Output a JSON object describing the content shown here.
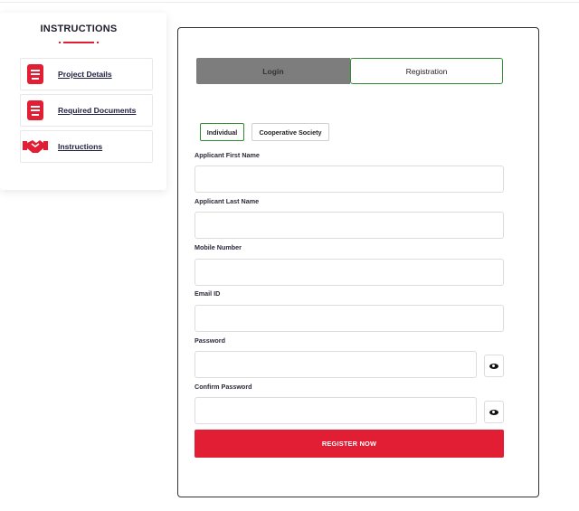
{
  "sidebar": {
    "title": "INSTRUCTIONS",
    "items": [
      {
        "label": "Project Details",
        "icon": "book-icon"
      },
      {
        "label": "Required Documents",
        "icon": "book-icon"
      },
      {
        "label": "Instructions",
        "icon": "handshake-icon"
      }
    ]
  },
  "tabs": {
    "login": "Login",
    "registration": "Registration",
    "active": "Registration"
  },
  "applicant_types": {
    "individual": "Individual",
    "cooperative": "Cooperative Society",
    "selected": "Individual"
  },
  "form": {
    "first_name": {
      "label": "Applicant First Name",
      "value": ""
    },
    "last_name": {
      "label": "Applicant Last Name",
      "value": ""
    },
    "mobile": {
      "label": "Mobile Number",
      "value": ""
    },
    "email": {
      "label": "Email ID",
      "value": ""
    },
    "password": {
      "label": "Password",
      "value": ""
    },
    "confirm_password": {
      "label": "Confirm Password",
      "value": ""
    },
    "submit_label": "REGISTER NOW"
  },
  "colors": {
    "accent_red": "#e21e35",
    "active_green": "#2e8b2e",
    "inactive_tab_gray": "#7d7d7d"
  }
}
